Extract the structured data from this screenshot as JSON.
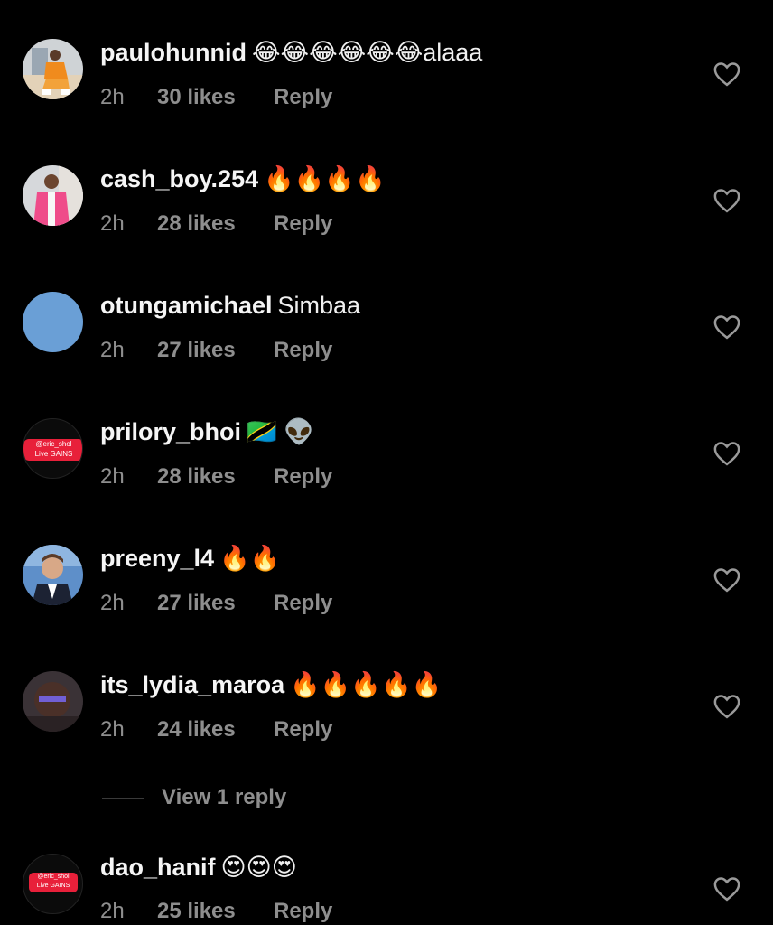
{
  "comments": [
    {
      "username": "paulohunnid",
      "text": "😂😂😂😂😂😂alaaa",
      "time": "2h",
      "likes": "30 likes",
      "reply": "Reply"
    },
    {
      "username": "cash_boy.254",
      "text": "🔥🔥🔥🔥",
      "time": "2h",
      "likes": "28 likes",
      "reply": "Reply"
    },
    {
      "username": "otungamichael",
      "text": "Simbaa",
      "time": "2h",
      "likes": "27 likes",
      "reply": "Reply"
    },
    {
      "username": "prilory_bhoi",
      "text": "🇹🇿 👽",
      "time": "2h",
      "likes": "28 likes",
      "reply": "Reply",
      "avatar_text": [
        "@eric_shol",
        "Live GAINS"
      ]
    },
    {
      "username": "preeny_l4",
      "text": "🔥🔥",
      "time": "2h",
      "likes": "27 likes",
      "reply": "Reply"
    },
    {
      "username": "its_lydia_maroa",
      "text": "🔥🔥🔥🔥🔥",
      "time": "2h",
      "likes": "24 likes",
      "reply": "Reply"
    },
    {
      "username": "dao_hanif",
      "text": "😍😍😍",
      "time": "2h",
      "likes": "25 likes",
      "reply": "Reply",
      "avatar_text": [
        "@eric_shol",
        "Live GAINS"
      ]
    }
  ],
  "view_replies": "View 1 reply",
  "icons": {
    "like": "heart-outline-icon"
  },
  "colors": {
    "background": "#000000",
    "meta_text": "#8e8e8e",
    "username": "#f5f5f5",
    "badge_red": "#e8203a",
    "placeholder_avatar": "#6a9fd6"
  }
}
